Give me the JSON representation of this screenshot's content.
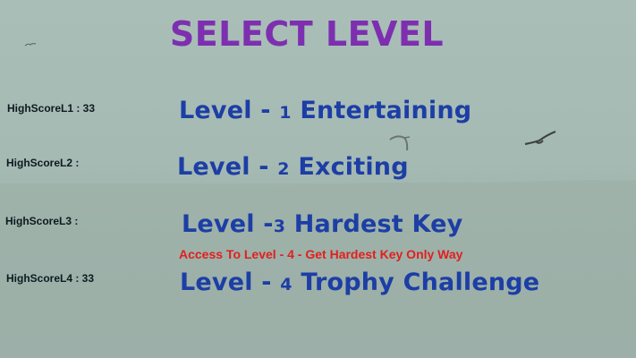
{
  "title": "SELECT LEVEL",
  "high_scores": {
    "l1": "HighScoreL1 : 33",
    "l2": "HighScoreL2 :",
    "l3": "HighScoreL3 :",
    "l4": "HighScoreL4 : 33"
  },
  "levels": [
    {
      "prefix": "Level  - ",
      "number": "1",
      "suffix": " Entertaining"
    },
    {
      "prefix": "Level  - ",
      "number": "2",
      "suffix": " Exciting"
    },
    {
      "prefix": "Level -",
      "number": "3",
      "suffix": " Hardest Key"
    },
    {
      "prefix": "Level  - ",
      "number": "4",
      "suffix": " Trophy Challenge"
    }
  ],
  "notice": "Access To Level - 4 - Get Hardest Key Only Way",
  "colors": {
    "title": "#7d2fb0",
    "level_text": "#1c3ea5",
    "notice": "#e0201e",
    "score_text": "#0e1a1e",
    "background": "#a6bab4"
  },
  "icons": {
    "bird_1": "bird-icon",
    "bird_2": "bird-icon",
    "bird_3": "bird-icon"
  }
}
